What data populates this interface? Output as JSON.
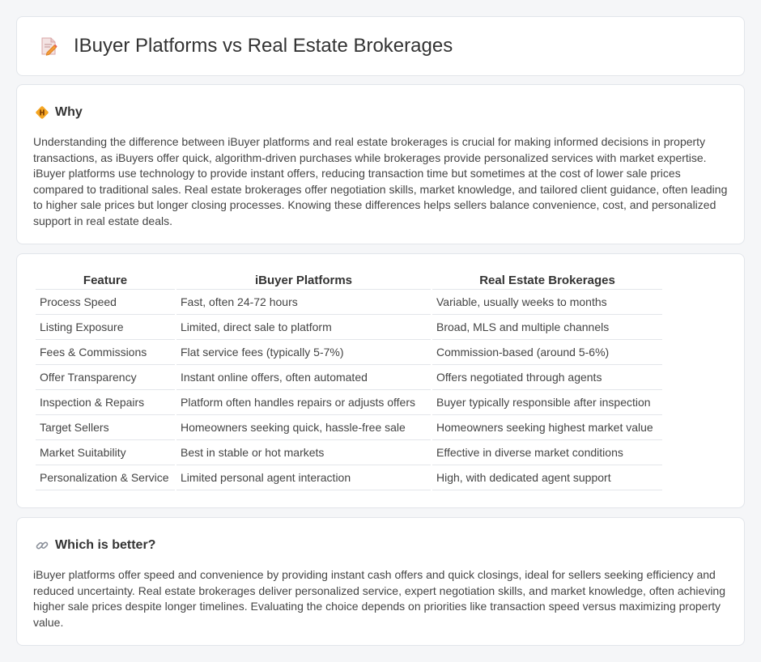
{
  "header": {
    "title": "IBuyer Platforms vs Real Estate Brokerages",
    "icon": "document-pencil-icon"
  },
  "why": {
    "icon": "diamond-warning-icon",
    "heading": "Why",
    "text": "Understanding the difference between iBuyer platforms and real estate brokerages is crucial for making informed decisions in property transactions, as iBuyers offer quick, algorithm-driven purchases while brokerages provide personalized services with market expertise. iBuyer platforms use technology to provide instant offers, reducing transaction time but sometimes at the cost of lower sale prices compared to traditional sales. Real estate brokerages offer negotiation skills, market knowledge, and tailored client guidance, often leading to higher sale prices but longer closing processes. Knowing these differences helps sellers balance convenience, cost, and personalized support in real estate deals."
  },
  "table": {
    "headers": [
      "Feature",
      "iBuyer Platforms",
      "Real Estate Brokerages"
    ],
    "rows": [
      [
        "Process Speed",
        "Fast, often 24-72 hours",
        "Variable, usually weeks to months"
      ],
      [
        "Listing Exposure",
        "Limited, direct sale to platform",
        "Broad, MLS and multiple channels"
      ],
      [
        "Fees & Commissions",
        "Flat service fees (typically 5-7%)",
        "Commission-based (around 5-6%)"
      ],
      [
        "Offer Transparency",
        "Instant online offers, often automated",
        "Offers negotiated through agents"
      ],
      [
        "Inspection & Repairs",
        "Platform often handles repairs or adjusts offers",
        "Buyer typically responsible after inspection"
      ],
      [
        "Target Sellers",
        "Homeowners seeking quick, hassle-free sale",
        "Homeowners seeking highest market value"
      ],
      [
        "Market Suitability",
        "Best in stable or hot markets",
        "Effective in diverse market conditions"
      ],
      [
        "Personalization & Service",
        "Limited personal agent interaction",
        "High, with dedicated agent support"
      ]
    ]
  },
  "better": {
    "icon": "link-icon",
    "heading": "Which is better?",
    "text": "iBuyer platforms offer speed and convenience by providing instant cash offers and quick closings, ideal for sellers seeking efficiency and reduced uncertainty. Real estate brokerages deliver personalized service, expert negotiation skills, and market knowledge, often achieving higher sale prices despite longer timelines. Evaluating the choice depends on priorities like transaction speed versus maximizing property value."
  }
}
